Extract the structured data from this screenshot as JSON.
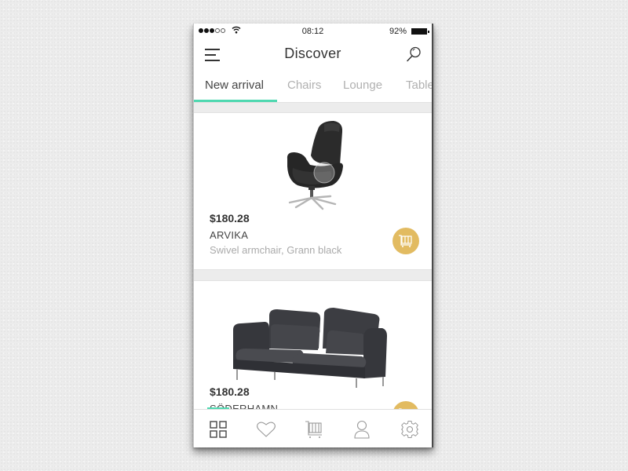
{
  "status_bar": {
    "signal_filled": 3,
    "signal_total": 5,
    "time": "08:12",
    "battery_percent": "92%",
    "battery_level": 0.92
  },
  "header": {
    "title": "Discover",
    "menu_icon": "hamburger-menu-icon",
    "search_icon": "search-icon"
  },
  "tabs": [
    {
      "label": "New arrival",
      "active": true
    },
    {
      "label": "Chairs",
      "active": false
    },
    {
      "label": "Lounge",
      "active": false
    },
    {
      "label": "Tables",
      "active": false
    }
  ],
  "products": [
    {
      "price": "$180.28",
      "name": "ARVIKA",
      "description": "Swivel armchair, Grann black",
      "image": "black-swivel-armchair",
      "action_icon": "cart-icon"
    },
    {
      "price": "$180.28",
      "name": "SÖDERHAMN",
      "description": "",
      "image": "dark-grey-sofa",
      "action_icon": "cart-icon"
    }
  ],
  "colors": {
    "accent": "#4ed8b0",
    "cart_button": "#e2bb61",
    "text_primary": "#333333",
    "text_muted": "#aaaaaa"
  },
  "bottom_nav": [
    {
      "icon": "grid-icon",
      "active": true
    },
    {
      "icon": "heart-icon",
      "active": false
    },
    {
      "icon": "cart-icon",
      "active": false
    },
    {
      "icon": "user-icon",
      "active": false
    },
    {
      "icon": "gear-icon",
      "active": false
    }
  ]
}
